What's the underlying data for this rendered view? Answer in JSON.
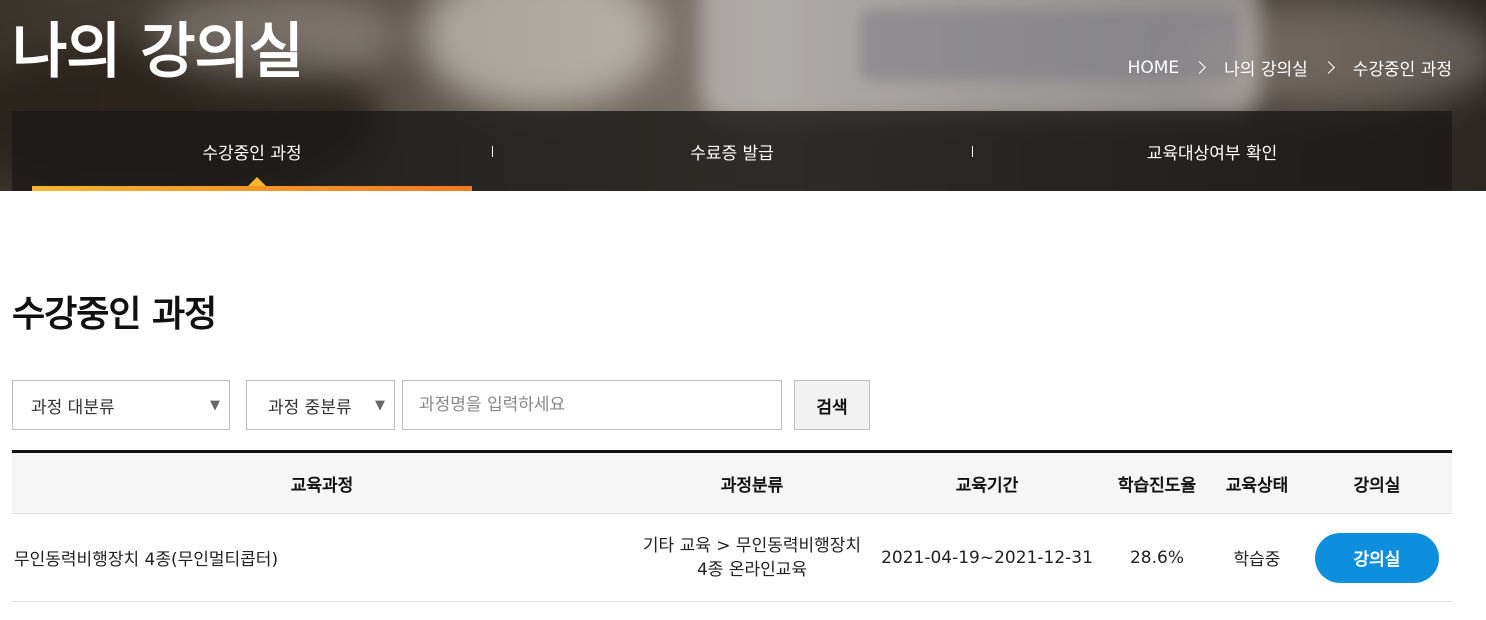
{
  "header": {
    "title": "나의 강의실",
    "breadcrumb": [
      "HOME",
      "나의 강의실",
      "수강중인 과정"
    ]
  },
  "tabs": [
    {
      "label": "수강중인 과정",
      "active": true
    },
    {
      "label": "수료증 발급",
      "active": false
    },
    {
      "label": "교육대상여부 확인",
      "active": false
    }
  ],
  "section": {
    "title": "수강중인 과정"
  },
  "filters": {
    "category_major": "과정 대분류",
    "category_minor": "과정 중분류",
    "search_placeholder": "과정명을 입력하세요",
    "search_button": "검색"
  },
  "table": {
    "headers": [
      "교육과정",
      "과정분류",
      "교육기간",
      "학습진도율",
      "교육상태",
      "강의실"
    ],
    "rows": [
      {
        "course": "무인동력비행장치 4종(무인멀티콥터)",
        "category_line1": "기타 교육 > 무인동력비행장치",
        "category_line2": "4종 온라인교육",
        "period": "2021-04-19~2021-12-31",
        "progress": "28.6%",
        "status": "학습중",
        "action": "강의실"
      }
    ]
  },
  "colors": {
    "accent_orange": "#f8b52e",
    "button_blue": "#0e8fde"
  }
}
